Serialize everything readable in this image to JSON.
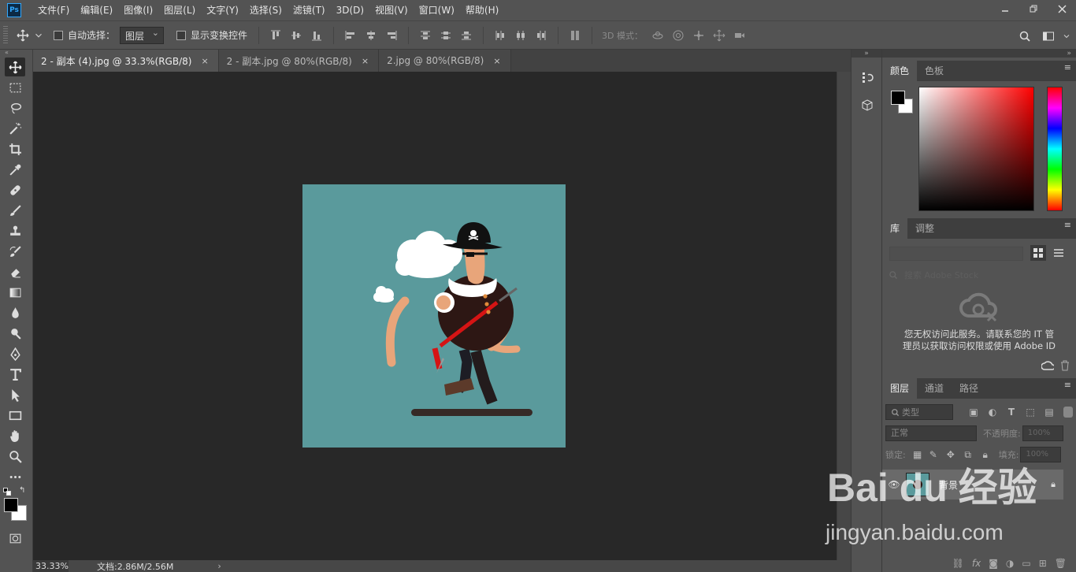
{
  "menubar": {
    "app_icon": "Ps",
    "items": [
      "文件(F)",
      "编辑(E)",
      "图像(I)",
      "图层(L)",
      "文字(Y)",
      "选择(S)",
      "滤镜(T)",
      "3D(D)",
      "视图(V)",
      "窗口(W)",
      "帮助(H)"
    ]
  },
  "options": {
    "auto_select_label": "自动选择：",
    "auto_select_value": "图层",
    "show_transform_label": "显示变换控件",
    "mode_3d_label": "3D 模式："
  },
  "tabs": [
    {
      "label": "2 - 副本 (4).jpg @ 33.3%(RGB/8)",
      "close": "×"
    },
    {
      "label": "2 - 副本.jpg @ 80%(RGB/8)",
      "close": "×"
    },
    {
      "label": "2.jpg @ 80%(RGB/8)",
      "close": "×"
    }
  ],
  "status": {
    "zoom": "33.33%",
    "doc": "文档:2.86M/2.56M",
    "arrow": "›"
  },
  "color_panel": {
    "tabs": [
      "颜色",
      "色板"
    ],
    "fg_color": "#000000",
    "bg_color": "#ffffff"
  },
  "library_panel": {
    "tabs": [
      "库",
      "调整"
    ],
    "search_placeholder": "搜索 Adobe Stock",
    "message_line1": "您无权访问此服务。请联系您的 IT 管",
    "message_line2": "理员以获取访问权限或使用 Adobe ID"
  },
  "layers_panel": {
    "tabs": [
      "图层",
      "通道",
      "路径"
    ],
    "filter_label": "类型",
    "blend_mode": "正常",
    "opacity_label": "不透明度:",
    "opacity_value": "100%",
    "lock_label": "锁定:",
    "fill_label": "填充:",
    "fill_value": "100%",
    "layers": [
      {
        "name": "背景"
      }
    ]
  },
  "watermark": {
    "brand": "Bai du 经验",
    "url": "jingyan.baidu.com"
  },
  "colors": {
    "accent": "#31a8ff",
    "canvas_bg": "#5a9a9c",
    "workspace": "#282828",
    "chrome": "#535353"
  }
}
